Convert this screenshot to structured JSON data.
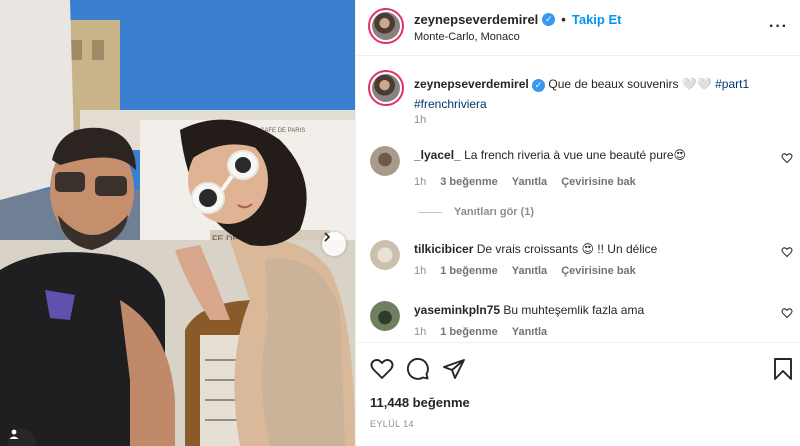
{
  "header": {
    "username": "zeynepseverdemirel",
    "follow_label": "Takip Et",
    "location": "Monte-Carlo, Monaco"
  },
  "caption": {
    "username": "zeynepseverdemirel",
    "text": "Que de beaux souvenirs",
    "emoji": "🤍🤍",
    "hashtag1": "#part1",
    "hashtag2": "#frenchriviera",
    "time": "1h"
  },
  "comments": [
    {
      "username": "_lyacel_",
      "text": "La french riveria à vue une beauté pure",
      "emoji": "😍",
      "time": "1h",
      "likes": "3 beğenme",
      "reply": "Yanıtla",
      "translate": "Çevirisine bak"
    },
    {
      "username": "tilkicibicer",
      "text": "De vrais croissants",
      "emoji": "😍",
      "text_after": "!! Un délice",
      "time": "1h",
      "likes": "1 beğenme",
      "reply": "Yanıtla",
      "translate": "Çevirisine bak"
    },
    {
      "username": "yaseminkpln75",
      "text": "Bu muhteşemlik fazla ama",
      "time": "1h",
      "likes": "1 beğenme",
      "reply": "Yanıtla"
    }
  ],
  "view_replies_label": "Yanıtları gör (1)",
  "post": {
    "likes": "11,448 beğenme",
    "date": "EYLÜL 14"
  },
  "colors": {
    "accent": "#0095f6",
    "hashtag": "#00376b",
    "muted": "#8e8e8e",
    "verified": "#3897f0"
  },
  "icons": [
    "verified-badge-icon",
    "more-options-icon",
    "heart-icon",
    "comment-icon",
    "share-icon",
    "bookmark-icon",
    "chevron-right-icon",
    "user-tag-icon"
  ]
}
